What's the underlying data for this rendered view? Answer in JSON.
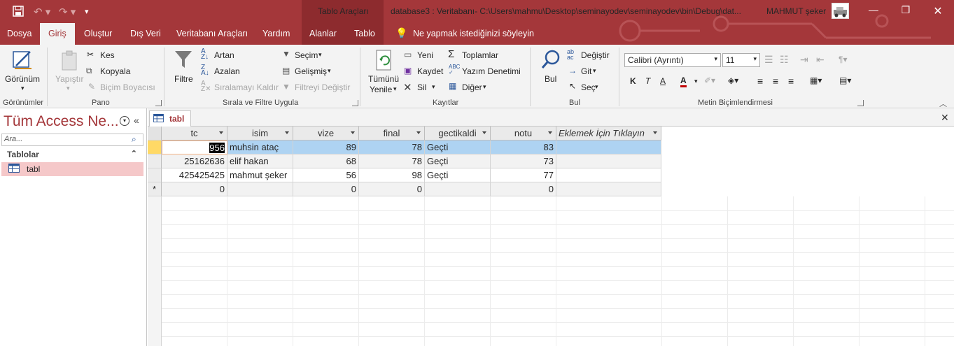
{
  "titlebar": {
    "context_title": "Tablo Araçları",
    "window_title": "database3 : Veritabanı- C:\\Users\\mahmu\\Desktop\\seminayodev\\seminayodev\\bin\\Debug\\dat...",
    "user_name": "MAHMUT şeker"
  },
  "tabs": [
    "Dosya",
    "Giriş",
    "Oluştur",
    "Dış Veri",
    "Veritabanı Araçları",
    "Yardım",
    "Alanlar",
    "Tablo"
  ],
  "tell_me": "Ne yapmak istediğinizi söyleyin",
  "ribbon": {
    "views": {
      "view_label": "Görünüm",
      "group": "Görünümler"
    },
    "clipboard": {
      "paste": "Yapıştır",
      "cut": "Kes",
      "copy": "Kopyala",
      "format_painter": "Biçim Boyacısı",
      "group": "Pano"
    },
    "sort": {
      "filter": "Filtre",
      "asc": "Artan",
      "desc": "Azalan",
      "remove_sort": "Sıralamayı Kaldır",
      "selection": "Seçim",
      "advanced": "Gelişmiş",
      "toggle_filter": "Filtreyi Değiştir",
      "group": "Sırala ve Filtre Uygula"
    },
    "records": {
      "refresh_1": "Tümünü",
      "refresh_2": "Yenile",
      "new": "Yeni",
      "save": "Kaydet",
      "delete": "Sil",
      "totals": "Toplamlar",
      "spelling": "Yazım Denetimi",
      "more": "Diğer",
      "group": "Kayıtlar"
    },
    "find": {
      "find": "Bul",
      "replace": "Değiştir",
      "goto": "Git",
      "select": "Seç",
      "group": "Bul"
    },
    "text": {
      "font": "Calibri (Ayrıntı)",
      "size": "11",
      "bold": "K",
      "italic": "T",
      "underline": "A",
      "group": "Metin Biçimlendirmesi"
    }
  },
  "nav": {
    "title": "Tüm Access Ne...",
    "search_placeholder": "Ara...",
    "category": "Tablolar",
    "items": [
      "tabl"
    ]
  },
  "document_tab": "tabl",
  "table": {
    "columns": [
      "tc",
      "isim",
      "vize",
      "final",
      "gectikaldi",
      "notu",
      "Eklemek İçin Tıklayın"
    ],
    "rows": [
      [
        "956",
        "muhsin ataç",
        "89",
        "78",
        "Geçti",
        "83"
      ],
      [
        "25162636",
        "elif hakan",
        "68",
        "78",
        "Geçti",
        "73"
      ],
      [
        "425425425",
        "mahmut şeker",
        "56",
        "98",
        "Geçti",
        "77"
      ]
    ],
    "new_row": [
      "0",
      "",
      "0",
      "0",
      "",
      "0"
    ],
    "new_row_marker": "*"
  },
  "colors": {
    "accent": "#a4373a",
    "selection": "#aed3f2",
    "current_row": "#ffd966"
  }
}
